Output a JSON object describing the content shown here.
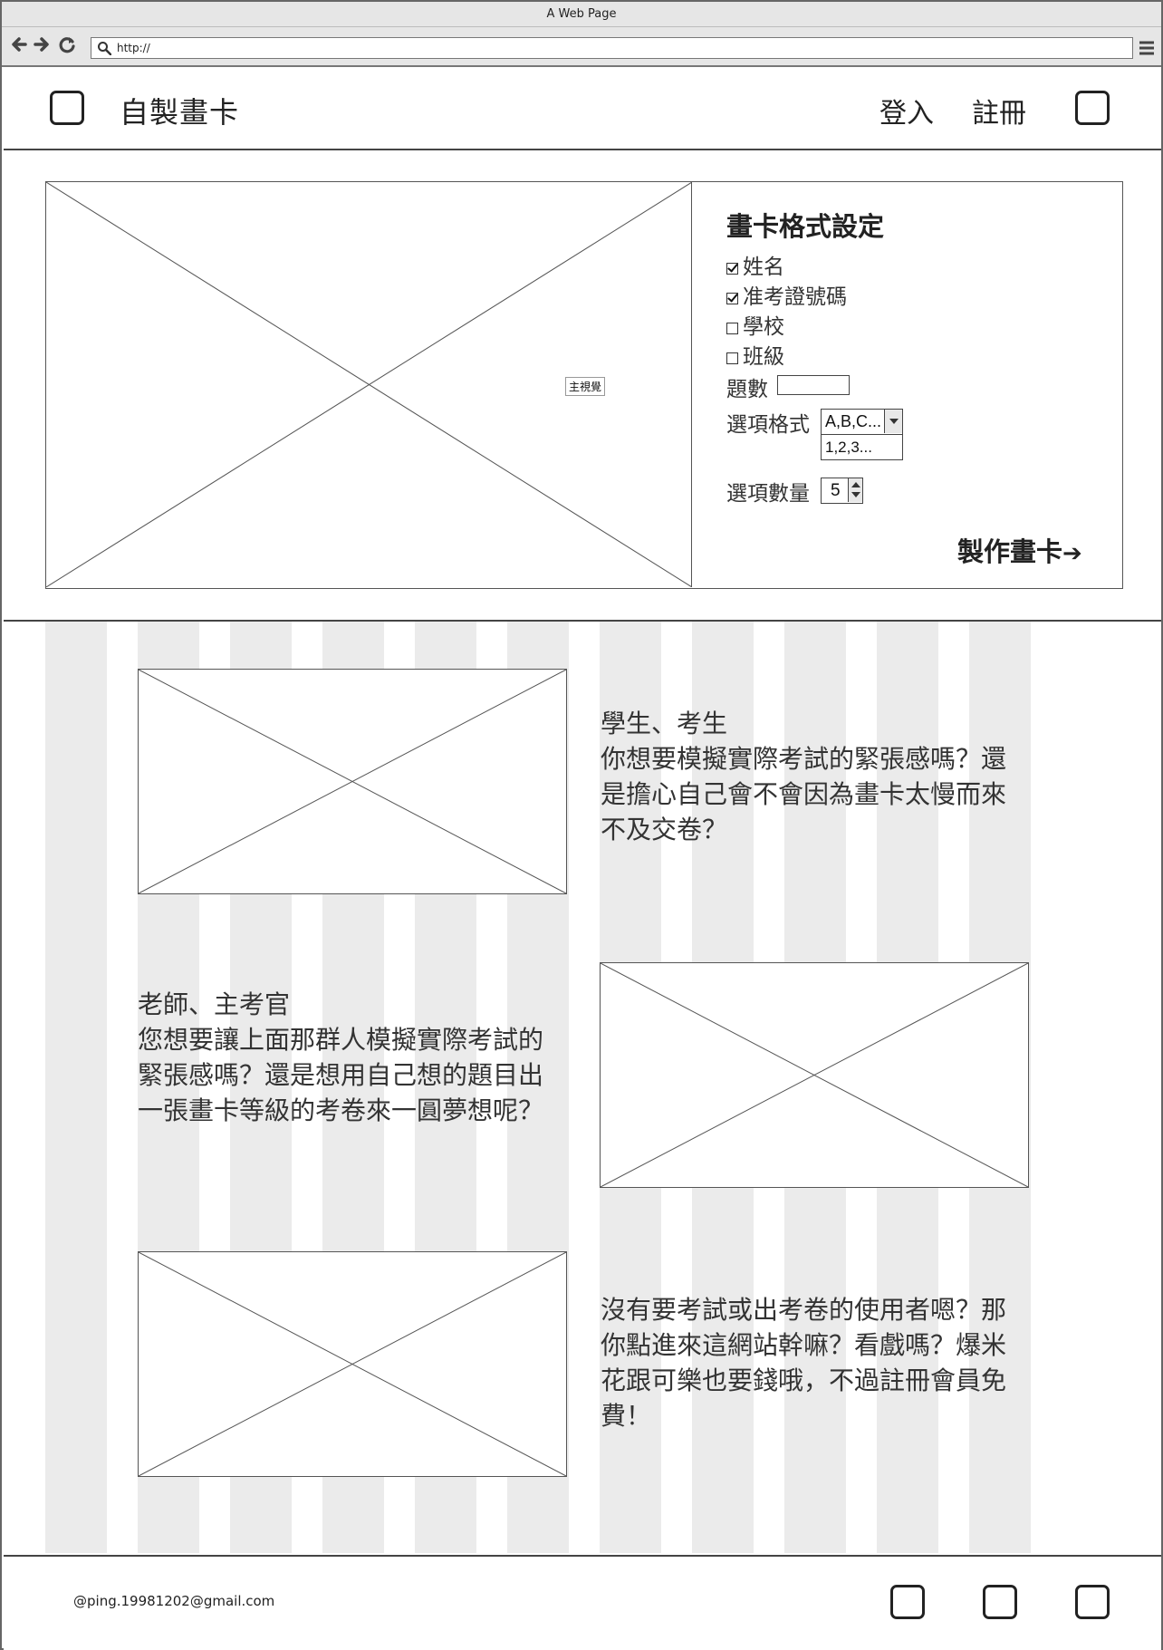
{
  "browser": {
    "window_title": "A Web Page",
    "url": "http://"
  },
  "header": {
    "site_title": "自製畫卡",
    "login_label": "登入",
    "register_label": "註冊"
  },
  "hero": {
    "image_caption": "主視覺"
  },
  "settings": {
    "title": "畫卡格式設定",
    "options": [
      {
        "label": "姓名",
        "checked": true
      },
      {
        "label": "准考證號碼",
        "checked": true
      },
      {
        "label": "學校",
        "checked": false
      },
      {
        "label": "班級",
        "checked": false
      }
    ],
    "question_count_label": "題數",
    "question_count_value": "",
    "choice_format_label": "選項格式",
    "choice_format_selected": "A,B,C...",
    "choice_format_option": "1,2,3...",
    "choice_count_label": "選項數量",
    "choice_count_value": "5",
    "make_card_label": "製作畫卡",
    "make_card_arrow": "➔"
  },
  "features": [
    {
      "title": "學生、考生",
      "body": "你想要模擬實際考試的緊張感嗎？還是擔心自己會不會因為畫卡太慢而來不及交卷？"
    },
    {
      "title": "老師、主考官",
      "body": "您想要讓上面那群人模擬實際考試的緊張感嗎？還是想用自己想的題目出一張畫卡等級的考卷來一圓夢想呢？"
    },
    {
      "title": "",
      "body": "沒有要考試或出考卷的使用者嗯？那你點進來這網站幹嘛？看戲嗎？爆米花跟可樂也要錢哦，不過註冊會員免費！"
    }
  ],
  "footer": {
    "email": "@ping.19981202@gmail.com"
  }
}
